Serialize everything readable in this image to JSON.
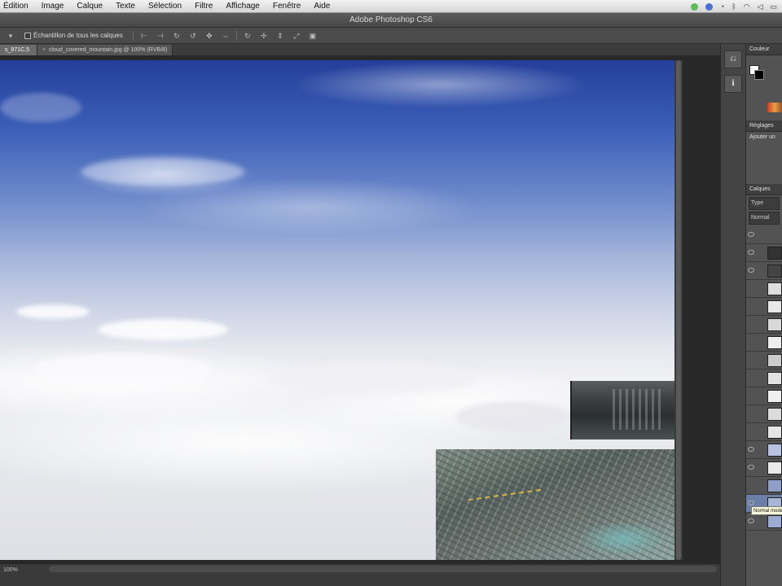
{
  "menubar": {
    "items": [
      "Édition",
      "Image",
      "Calque",
      "Texte",
      "Sélection",
      "Filtre",
      "Affichage",
      "Fenêtre",
      "Aide"
    ]
  },
  "window": {
    "title": "Adobe Photoshop CS6"
  },
  "options": {
    "checkbox_label": "Échantillon de tous les calques"
  },
  "tabs": [
    {
      "label": "s_971C,5"
    },
    {
      "label": "cloud_covered_mountain.jpg @ 100% (RVB/8)"
    }
  ],
  "status": {
    "zoom": "100%"
  },
  "panels": {
    "color_header": "Couleur",
    "adjustments_header": "Réglages",
    "adjustments_add": "Ajouter un",
    "layers_header": "Calques",
    "filter_kind": "Type",
    "blend_mode": "Normal"
  },
  "tooltip": "Normal mode"
}
